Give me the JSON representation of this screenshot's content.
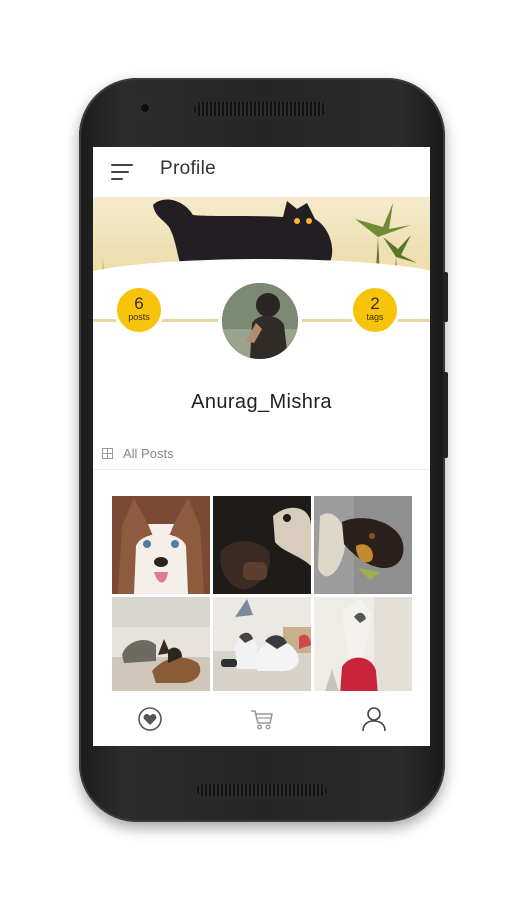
{
  "app": {
    "title": "Profile"
  },
  "profile": {
    "username": "Anurag_Mishra",
    "posts": {
      "count": "6",
      "label": "posts"
    },
    "tags": {
      "count": "2",
      "label": "tags"
    }
  },
  "gallery": {
    "section_label": "All Posts",
    "photos": [
      {
        "name": "husky-closeup"
      },
      {
        "name": "dog-with-person"
      },
      {
        "name": "dog-rotated"
      },
      {
        "name": "dogs-on-floor"
      },
      {
        "name": "huskies-on-floor"
      },
      {
        "name": "dog-by-red-bag"
      }
    ]
  },
  "bottom_nav": {
    "items": [
      {
        "icon": "heart-circle-icon",
        "active": true
      },
      {
        "icon": "cart-icon",
        "active": false
      },
      {
        "icon": "person-icon",
        "active": false
      }
    ]
  },
  "colors": {
    "accent": "#f7c40b",
    "text": "#222222",
    "muted": "#888888"
  }
}
